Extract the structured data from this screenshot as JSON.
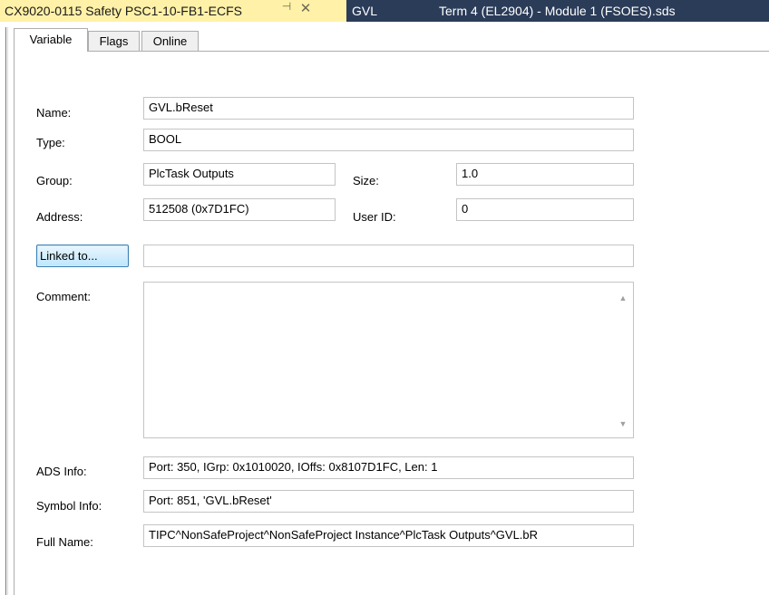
{
  "doc_tabs": {
    "active": "CX9020-0115 Safety PSC1-10-FB1-ECFS",
    "pin": "⊣",
    "close": "✕",
    "second": "GVL",
    "third": "Term 4 (EL2904) - Module 1 (FSOES).sds"
  },
  "prop_tabs": {
    "variable": "Variable",
    "flags": "Flags",
    "online": "Online"
  },
  "fields": {
    "name_label": "Name:",
    "name_value": "GVL.bReset",
    "type_label": "Type:",
    "type_value": "BOOL",
    "group_label": "Group:",
    "group_value": "PlcTask Outputs",
    "size_label": "Size:",
    "size_value": "1.0",
    "address_label": "Address:",
    "address_value": "512508 (0x7D1FC)",
    "userid_label": "User ID:",
    "userid_value": "0",
    "linked_button": "Linked to...",
    "linked_value": "",
    "comment_label": "Comment:",
    "comment_value": "",
    "ads_label": "ADS Info:",
    "ads_value": "Port: 350, IGrp: 0x1010020, IOffs: 0x8107D1FC, Len: 1",
    "symbol_label": "Symbol Info:",
    "symbol_value": "Port: 851, 'GVL.bReset'",
    "fullname_label": "Full Name:",
    "fullname_value": "TIPC^NonSafeProject^NonSafeProject Instance^PlcTask Outputs^GVL.bR"
  }
}
